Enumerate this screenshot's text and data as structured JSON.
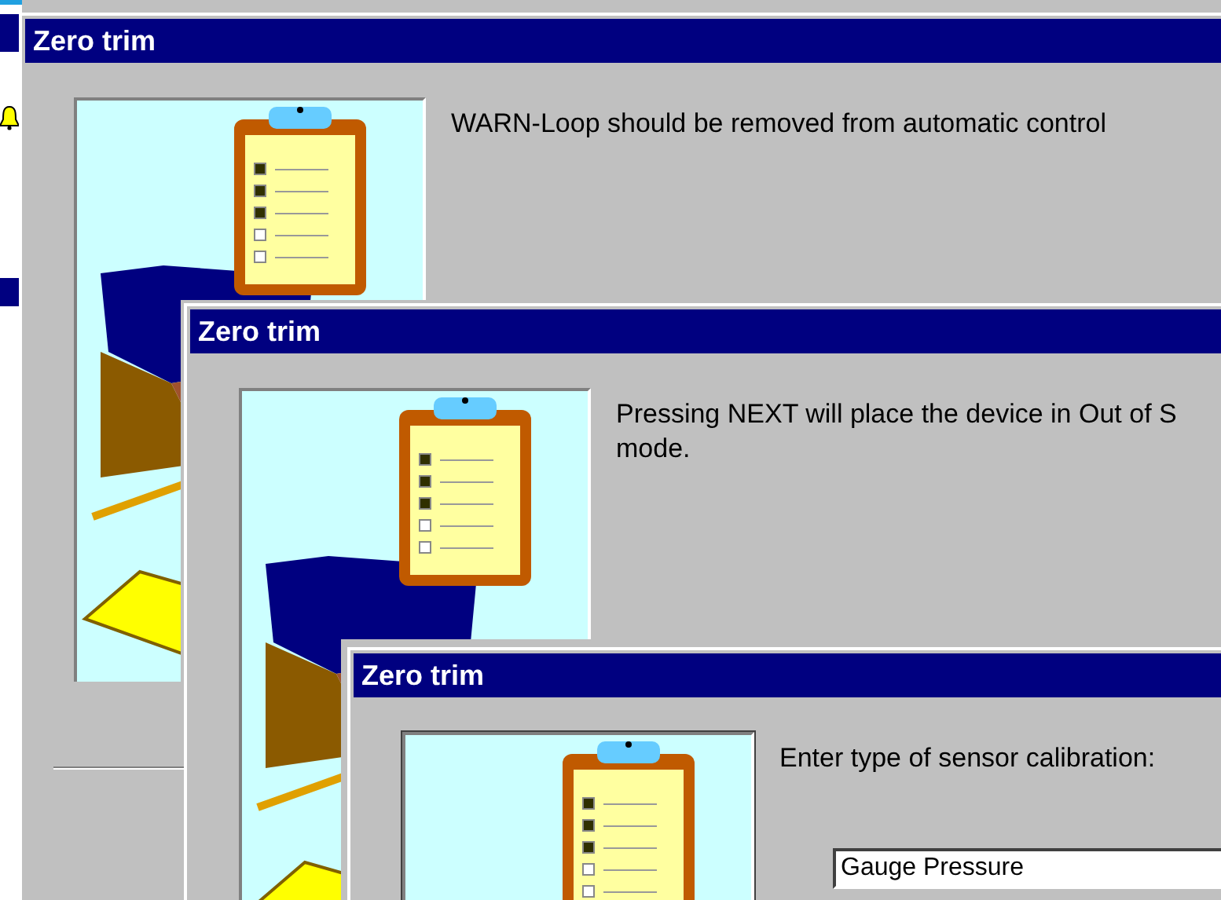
{
  "windows": [
    {
      "title": "Zero trim",
      "lines": [
        "WARN-Loop should be removed from automatic control"
      ]
    },
    {
      "title": "Zero trim",
      "lines": [
        "Pressing NEXT will place the device in Out of S",
        "mode."
      ]
    },
    {
      "title": "Zero trim",
      "lines": [
        "Enter type of sensor calibration:"
      ],
      "dropdown": {
        "value": "Gauge Pressure"
      }
    }
  ]
}
